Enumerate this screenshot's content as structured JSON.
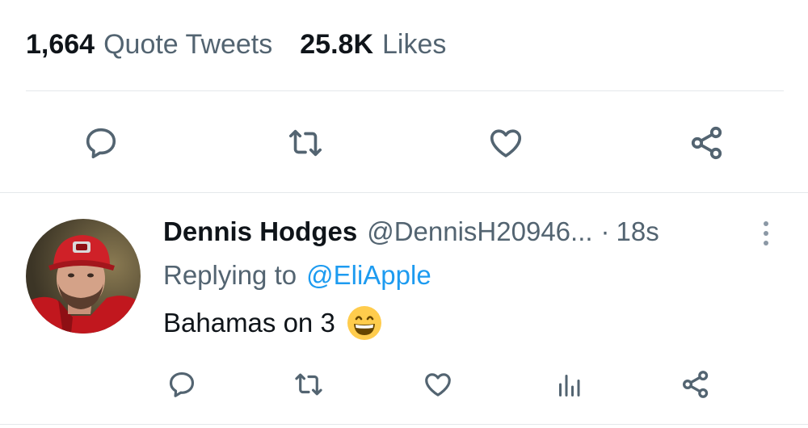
{
  "stats": {
    "quote_tweets": {
      "value": "1,664",
      "label": "Quote Tweets"
    },
    "likes": {
      "value": "25.8K",
      "label": "Likes"
    }
  },
  "main_actions": {
    "icons": [
      "reply-icon",
      "retweet-icon",
      "like-icon",
      "share-icon"
    ]
  },
  "reply": {
    "author": {
      "name": "Dennis Hodges",
      "handle": "@DennisH20946...",
      "avatar_icon": "avatar"
    },
    "separator": "·",
    "time": "18s",
    "replying_to": {
      "prefix": "Replying to",
      "mention": "@EliApple"
    },
    "text": "Bahamas on 3",
    "emoji": "grinning-face-icon",
    "actions": {
      "icons": [
        "reply-icon",
        "retweet-icon",
        "like-icon",
        "analytics-icon",
        "share-icon"
      ]
    }
  },
  "colors": {
    "text_primary": "#0f1419",
    "text_secondary": "#536471",
    "accent": "#1d9bf0",
    "divider": "#e4e8eb"
  }
}
